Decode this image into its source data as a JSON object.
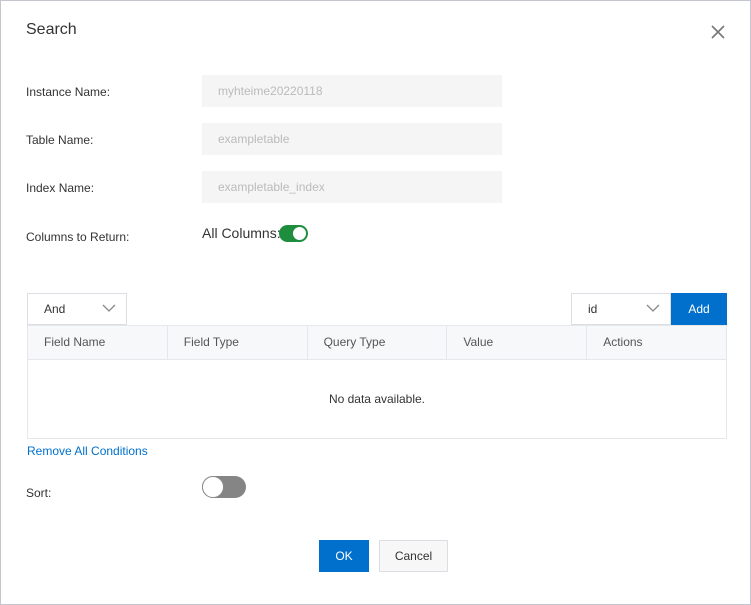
{
  "dialog": {
    "title": "Search",
    "close_icon": "close-icon"
  },
  "form": {
    "instance_name": {
      "label": "Instance Name:",
      "value": "myhteime20220118"
    },
    "table_name": {
      "label": "Table Name:",
      "value": "exampletable"
    },
    "index_name": {
      "label": "Index Name:",
      "value": "exampletable_index"
    },
    "columns_to_return": {
      "label": "Columns to Return:",
      "switch_label": "All Columns:",
      "enabled": true
    },
    "sort": {
      "label": "Sort:",
      "enabled": false
    }
  },
  "conditions": {
    "logic_select": {
      "value": "And"
    },
    "field_select": {
      "value": "id"
    },
    "add_label": "Add",
    "table": {
      "columns": [
        "Field Name",
        "Field Type",
        "Query Type",
        "Value",
        "Actions"
      ],
      "rows": [],
      "empty_text": "No data available."
    },
    "remove_all_label": "Remove All Conditions"
  },
  "footer": {
    "ok_label": "OK",
    "cancel_label": "Cancel"
  },
  "colors": {
    "primary": "#0070cc",
    "switch_on": "#1e8e3e",
    "switch_off": "#858585"
  }
}
